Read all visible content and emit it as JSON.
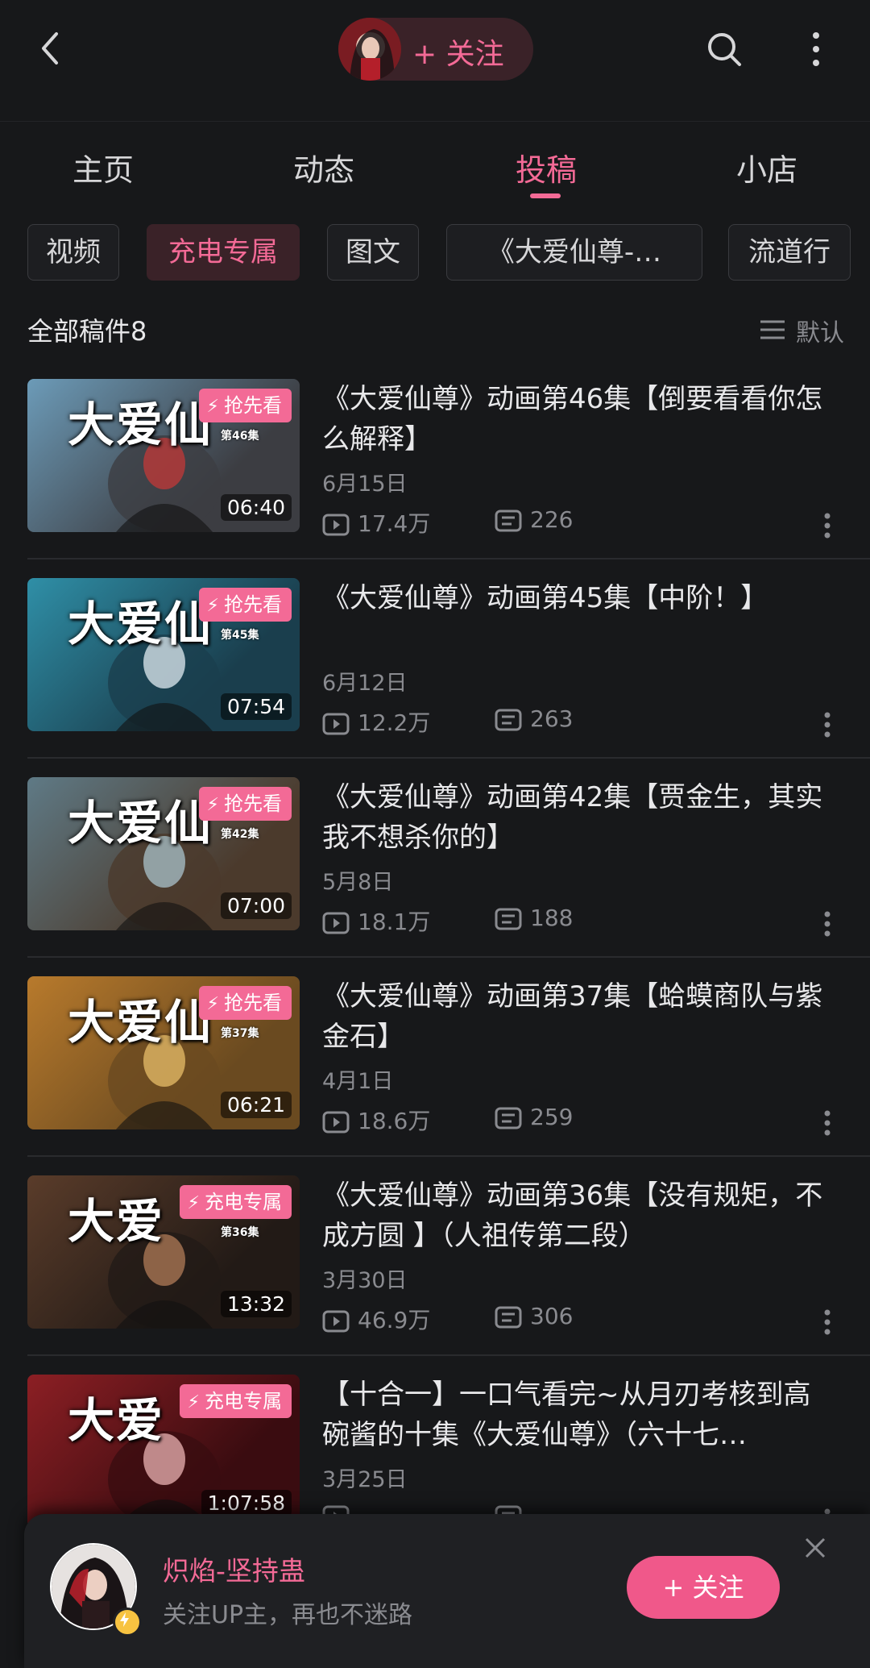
{
  "header": {
    "follow_label": "+ 关注",
    "icons": {
      "back": "back-arrow-icon",
      "search": "search-icon",
      "more": "more-vertical-icon"
    }
  },
  "tabs": [
    {
      "label": "主页"
    },
    {
      "label": "动态"
    },
    {
      "label": "投稿",
      "active": true
    },
    {
      "label": "小店"
    }
  ],
  "chips": [
    {
      "label": "视频"
    },
    {
      "label": "充电专属",
      "active": true
    },
    {
      "label": "图文"
    },
    {
      "label": "《大爱仙尊-…"
    },
    {
      "label": "流道行"
    }
  ],
  "summary": {
    "count_label": "全部稿件8",
    "sort_label": "默认"
  },
  "videos": [
    {
      "badge": "抢先看",
      "thumb_text": "大爱仙",
      "ep_text": "第46集",
      "duration": "06:40",
      "title": "《大爱仙尊》动画第46集【倒要看看你怎么解释】",
      "date": "6月15日",
      "views": "17.4万",
      "danmaku": "226"
    },
    {
      "badge": "抢先看",
      "thumb_text": "大爱仙",
      "ep_text": "第45集",
      "duration": "07:54",
      "title": "《大爱仙尊》动画第45集【中阶！】",
      "date": "6月12日",
      "views": "12.2万",
      "danmaku": "263"
    },
    {
      "badge": "抢先看",
      "thumb_text": "大爱仙",
      "ep_text": "第42集",
      "duration": "07:00",
      "title": "《大爱仙尊》动画第42集【贾金生，其实我不想杀你的】",
      "date": "5月8日",
      "views": "18.1万",
      "danmaku": "188"
    },
    {
      "badge": "抢先看",
      "thumb_text": "大爱仙",
      "ep_text": "第37集",
      "duration": "06:21",
      "title": "《大爱仙尊》动画第37集【蛤蟆商队与紫金石】",
      "date": "4月1日",
      "views": "18.6万",
      "danmaku": "259"
    },
    {
      "badge": "充电专属",
      "thumb_text": "大爱",
      "ep_text": "第36集",
      "duration": "13:32",
      "title": "《大爱仙尊》动画第36集【没有规矩，不成方圆 】（人祖传第二段）",
      "date": "3月30日",
      "views": "46.9万",
      "danmaku": "306"
    },
    {
      "badge": "充电专属",
      "thumb_text": "大爱",
      "ep_text": "",
      "duration": "1:07:58",
      "title": "【十合一】一口气看完~从月刃考核到高碗酱的十集《大爱仙尊》（六十七…",
      "date": "3月25日",
      "views": "",
      "danmaku": ""
    }
  ],
  "follow_sheet": {
    "name": "炽焰-坚持蛊",
    "subtitle": "关注UP主，再也不迷路",
    "button_label": "+ 关注"
  },
  "colors": {
    "accent": "#f36a96",
    "background": "#17181a",
    "muted": "#8a8b90"
  }
}
